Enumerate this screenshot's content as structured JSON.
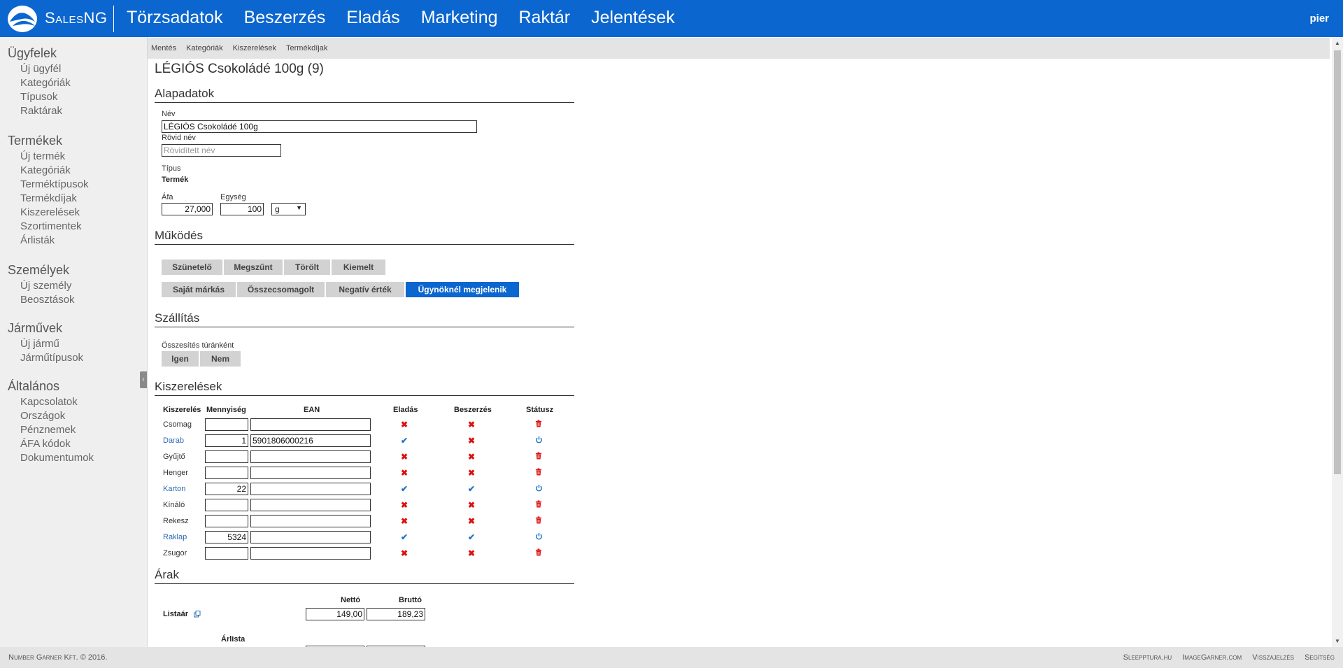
{
  "brand": "SalesNG",
  "user": "pier",
  "nav": [
    "Törzsadatok",
    "Beszerzés",
    "Eladás",
    "Marketing",
    "Raktár",
    "Jelentések"
  ],
  "sidebar": [
    {
      "title": "Ügyfelek",
      "items": [
        "Új ügyfél",
        "Kategóriák",
        "Típusok",
        "Raktárak"
      ]
    },
    {
      "title": "Termékek",
      "items": [
        "Új termék",
        "Kategóriák",
        "Terméktípusok",
        "Termékdíjak",
        "Kiszerelések",
        "Szortimentek",
        "Árlisták"
      ]
    },
    {
      "title": "Személyek",
      "items": [
        "Új személy",
        "Beosztások"
      ]
    },
    {
      "title": "Járművek",
      "items": [
        "Új jármű",
        "Járműtípusok"
      ]
    },
    {
      "title": "Általános",
      "items": [
        "Kapcsolatok",
        "Országok",
        "Pénznemek",
        "ÁFA kódok",
        "Dokumentumok"
      ]
    }
  ],
  "toolbar": [
    "Mentés",
    "Kategóriák",
    "Kiszerelések",
    "Termékdíjak"
  ],
  "page_title": "LÉGIÓS Csokoládé 100g (9)",
  "sections": {
    "alapadatok": "Alapadatok",
    "mukodes": "Működés",
    "szallitas": "Szállítás",
    "kiszerelesek": "Kiszerelések",
    "arak": "Árak"
  },
  "form": {
    "nev_label": "Név",
    "nev_value": "LÉGIÓS Csokoládé 100g",
    "rovid_label": "Rövid név",
    "rovid_placeholder": "Rövidített név",
    "tipus_label": "Típus",
    "tipus_value": "Termék",
    "afa_label": "Áfa",
    "afa_value": "27,000",
    "egyseg_label": "Egység",
    "egyseg_value": "100",
    "egyseg_unit": "g"
  },
  "mukodes": {
    "row1": [
      {
        "label": "Szünetelő",
        "active": false
      },
      {
        "label": "Megszűnt",
        "active": false
      },
      {
        "label": "Törölt",
        "active": false
      },
      {
        "label": "Kiemelt",
        "active": false
      }
    ],
    "row2": [
      {
        "label": "Saját márkás",
        "active": false
      },
      {
        "label": "Összecsomagolt",
        "active": false
      },
      {
        "label": "Negatív érték",
        "active": false
      },
      {
        "label": "Ügynöknél megjelenik",
        "active": true
      }
    ]
  },
  "szallitas": {
    "label": "Összesítés túránként",
    "buttons": [
      "Igen",
      "Nem"
    ]
  },
  "kiszerelesek": {
    "headers": [
      "Kiszerelés",
      "Mennyiség",
      "EAN",
      "Eladás",
      "Beszerzés",
      "Státusz"
    ],
    "rows": [
      {
        "name": "Csomag",
        "qty": "",
        "ean": "",
        "sale": false,
        "purchase": false,
        "active": false
      },
      {
        "name": "Darab",
        "qty": "1",
        "ean": "5901806000216",
        "sale": true,
        "purchase": false,
        "active": true
      },
      {
        "name": "Gyűjtő",
        "qty": "",
        "ean": "",
        "sale": false,
        "purchase": false,
        "active": false
      },
      {
        "name": "Henger",
        "qty": "",
        "ean": "",
        "sale": false,
        "purchase": false,
        "active": false
      },
      {
        "name": "Karton",
        "qty": "22",
        "ean": "",
        "sale": true,
        "purchase": true,
        "active": true
      },
      {
        "name": "Kínáló",
        "qty": "",
        "ean": "",
        "sale": false,
        "purchase": false,
        "active": false
      },
      {
        "name": "Rekesz",
        "qty": "",
        "ean": "",
        "sale": false,
        "purchase": false,
        "active": false
      },
      {
        "name": "Raklap",
        "qty": "5324",
        "ean": "",
        "sale": true,
        "purchase": true,
        "active": true
      },
      {
        "name": "Zsugor",
        "qty": "",
        "ean": "",
        "sale": false,
        "purchase": false,
        "active": false
      }
    ]
  },
  "arak": {
    "netto_header": "Nettó",
    "brutto_header": "Bruttó",
    "listaar_label": "Listaár",
    "netto_value": "149,00",
    "brutto_value": "189,23",
    "arlista_label": "Árlista"
  },
  "footer": {
    "copyright": "Number Garner Kft. © 2016.",
    "links": [
      "Sleepptura.hu",
      "ImageGarner.com",
      "Visszajelzés",
      "Segítség"
    ]
  },
  "colors": {
    "primary": "#0b66cf",
    "error": "#dd1111",
    "ok": "#1c74c8"
  },
  "icons": {
    "sale_no": "cross-icon",
    "sale_yes": "check-icon",
    "status_inactive": "trash-icon",
    "status_active": "power-icon"
  }
}
